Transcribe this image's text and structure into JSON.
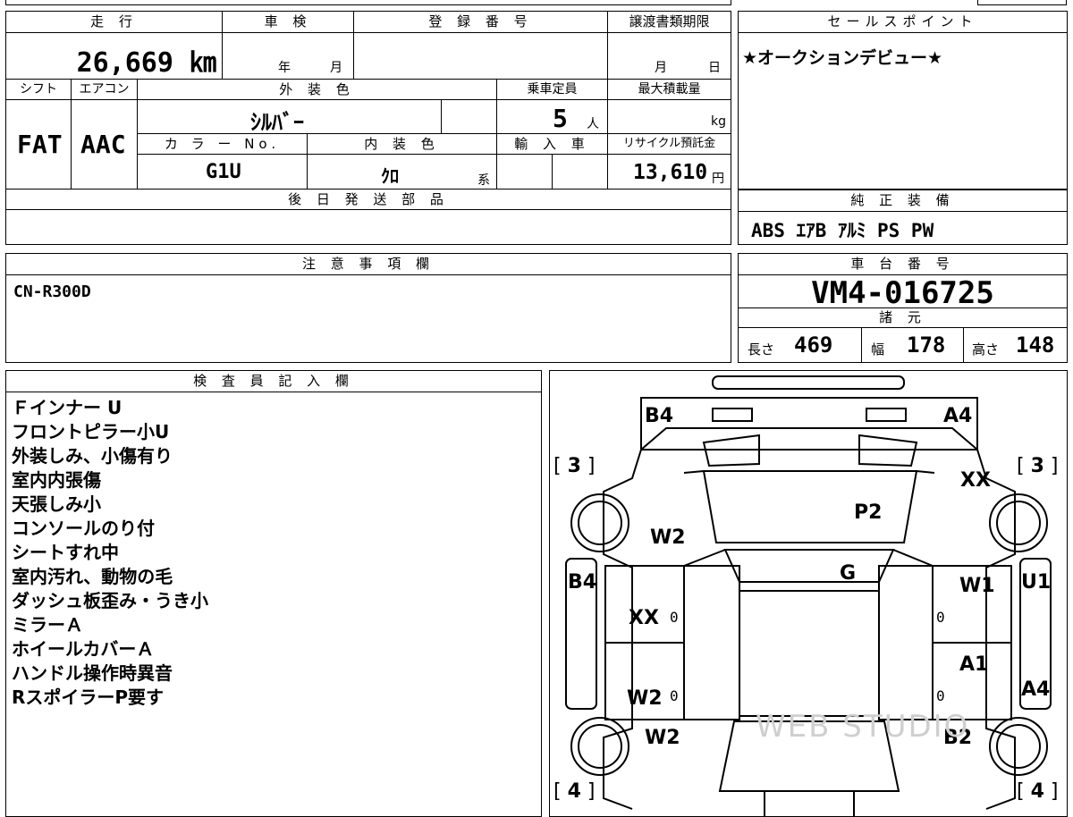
{
  "top_left": {
    "mileage_header": "走 行",
    "mileage": "26,669 ㎞",
    "inspection_header": "車 検",
    "inspection_year": "年",
    "inspection_month": "月",
    "registration_header": "登 録 番 号",
    "transfer_header": "譲渡書類期限",
    "transfer_month": "月",
    "transfer_day": "日",
    "shift_header": "シフト",
    "shift_value": "FAT",
    "ac_header": "エアコン",
    "ac_value": "AAC",
    "exterior_color_header": "外 装 色",
    "exterior_color_value": "ｼﾙﾊﾞｰ",
    "capacity_header": "乗車定員",
    "capacity_value": "5",
    "capacity_unit": "人",
    "max_load_header": "最大積載量",
    "max_load_unit": "kg",
    "color_no_header": "カ ラ ー No.",
    "color_no_value": "G1U",
    "interior_color_header": "内 装 色",
    "interior_color_value": "ｸﾛ",
    "interior_suffix": "系",
    "import_header": "輸 入 車",
    "recycle_header": "リサイクル預託金",
    "recycle_value": "13,610",
    "recycle_unit": "円",
    "later_parts_header": "後 日 発 送 部 品"
  },
  "sales_point": {
    "header": "セールスポイント",
    "text": "★オークションデビュー★"
  },
  "genuine_equipment": {
    "header": "純 正 装 備",
    "text": "ABS ｴｱB ｱﾙﾐ PS PW"
  },
  "notes": {
    "header": "注 意 事 項 欄",
    "text": "CN-R300D"
  },
  "chassis": {
    "header": "車 台 番 号",
    "value": "VM4-016725",
    "specs_header": "諸 元",
    "length_label": "長さ",
    "length_value": "469",
    "width_label": "幅",
    "width_value": "178",
    "height_label": "高さ",
    "height_value": "148"
  },
  "inspector": {
    "header": "検 査 員 記 入 欄",
    "lines": [
      "Ｆインナー U",
      "フロントピラー小U",
      "外装しみ、小傷有り",
      "室内内張傷",
      "天張しみ小",
      "コンソールのり付",
      "シートすれ中",
      "室内汚れ、動物の毛",
      "ダッシュ板歪み・うき小",
      "ミラーＡ",
      "ホイールカバーＡ",
      "ハンドル操作時異音",
      "RスポイラーP要す"
    ]
  },
  "diagram": {
    "marks": {
      "b4_top": "B4",
      "a4_top": "A4",
      "xx_right": "XX",
      "p2": "P2",
      "w2_left_upper": "W2",
      "g": "G",
      "b4_left": "B4",
      "w1": "W1",
      "u1": "U1",
      "xx_left": "XX",
      "a1": "A1",
      "w2_left_lower": "W2",
      "a4_right": "A4",
      "w2_bottom": "W2",
      "b2": "B2"
    },
    "tire_front_left": "3",
    "tire_front_right": "3",
    "tire_rear_left": "4",
    "tire_rear_right": "4",
    "zero": "0",
    "watermark": "WEB STUDIO"
  }
}
